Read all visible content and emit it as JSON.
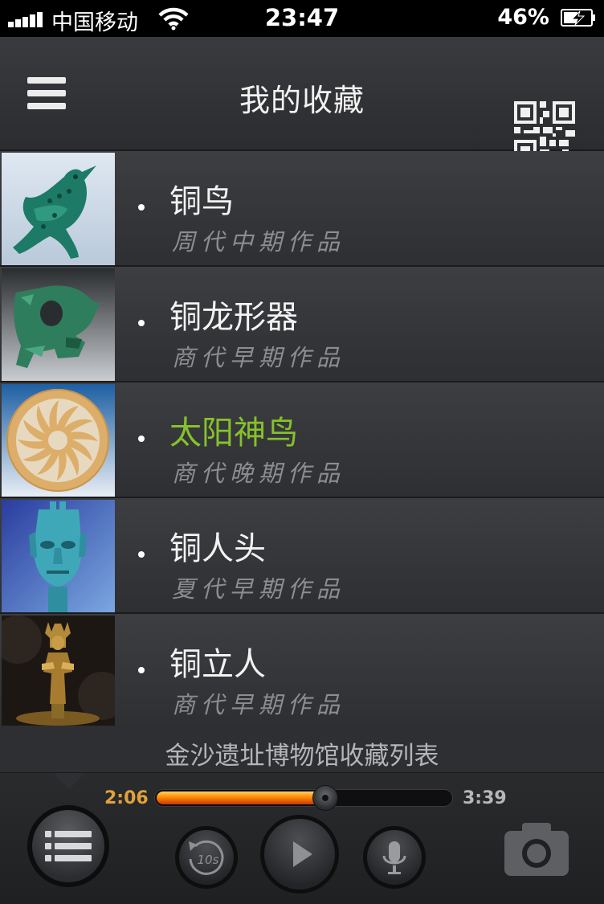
{
  "status_bar": {
    "carrier": "中国移动",
    "time": "23:47",
    "battery_percent": "46%",
    "icons": [
      "signal-icon",
      "wifi-icon",
      "battery-charging-icon"
    ]
  },
  "nav": {
    "title": "我的收藏",
    "left_icon": "menu-icon",
    "right_icon": "qr-code-icon"
  },
  "items": [
    {
      "title": "铜鸟",
      "subtitle": "周代中期作品",
      "active": false
    },
    {
      "title": "铜龙形器",
      "subtitle": "商代早期作品",
      "active": false
    },
    {
      "title": "太阳神鸟",
      "subtitle": "商代晚期作品",
      "active": true
    },
    {
      "title": "铜人头",
      "subtitle": "夏代早期作品",
      "active": false
    },
    {
      "title": "铜立人",
      "subtitle": "商代早期作品",
      "active": false
    }
  ],
  "footer": {
    "caption": "金沙遗址博物馆收藏列表"
  },
  "player": {
    "elapsed": "2:06",
    "total": "3:39",
    "progress_fraction": 0.575,
    "rewind_label": "10s",
    "buttons": [
      "list-icon",
      "rewind-10s-icon",
      "play-icon",
      "microphone-icon",
      "camera-icon"
    ]
  },
  "colors": {
    "active_title": "#86c22b",
    "elapsed_time": "#e1a23a",
    "progress": "#ff8a00"
  }
}
